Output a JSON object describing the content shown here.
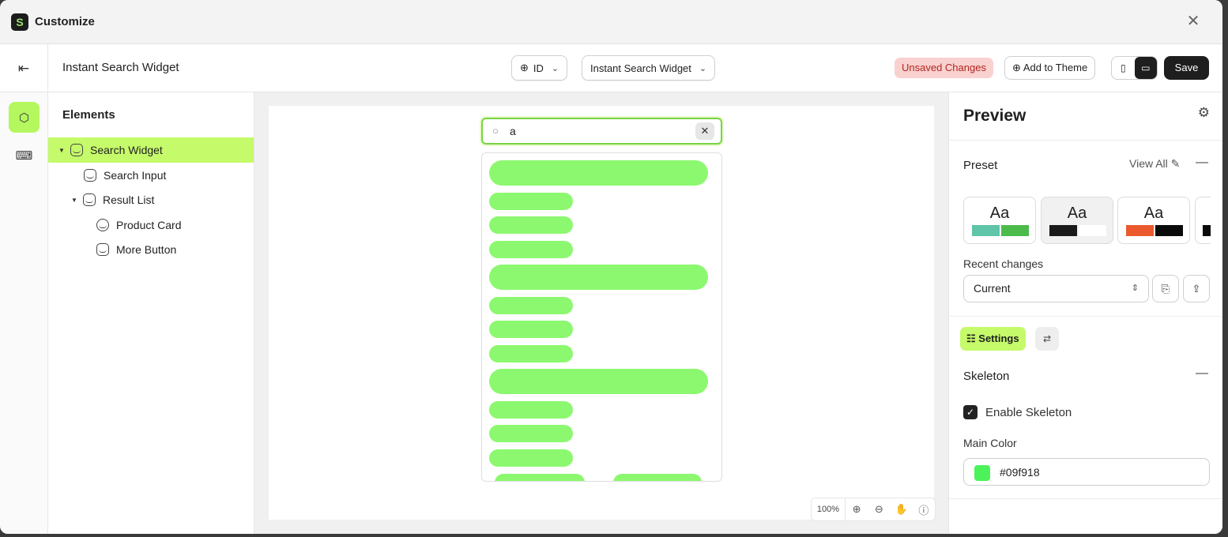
{
  "app": {
    "title": "Customize",
    "logo_letter": "S"
  },
  "toolbar": {
    "widget_name": "Instant Search Widget",
    "language": "ID",
    "widget_select": "Instant Search Widget",
    "unsaved": "Unsaved Changes",
    "add_to_theme": "Add to Theme",
    "save": "Save"
  },
  "elements": {
    "heading": "Elements",
    "tree": [
      {
        "label": "Search Widget",
        "selected": true
      },
      {
        "label": "Search Input"
      },
      {
        "label": "Result List"
      },
      {
        "label": "Product Card"
      },
      {
        "label": "More Button"
      }
    ]
  },
  "canvas": {
    "search_query": "a",
    "zoom": "100%",
    "skeleton_color": "#8cf86f"
  },
  "preview": {
    "title": "Preview",
    "preset_label": "Preset",
    "view_all": "View All",
    "presets": [
      {
        "label": "Aa",
        "colors": [
          "#5fc4a8",
          "#4cbb4c"
        ]
      },
      {
        "label": "Aa",
        "colors": [
          "#1a1a1a",
          "#ffffff"
        ]
      },
      {
        "label": "Aa",
        "colors": [
          "#ea5a2e",
          "#0a0a0a"
        ]
      }
    ],
    "recent_changes_label": "Recent changes",
    "recent_value": "Current",
    "settings_tab": "Settings",
    "skeleton_heading": "Skeleton",
    "enable_skeleton": "Enable Skeleton",
    "main_color_label": "Main Color",
    "main_color": "#09f918"
  },
  "colors": {
    "accent": "#c5fa6a",
    "unsaved_bg": "#f9d1cf",
    "unsaved_text": "#b3261e",
    "search_border": "#7ad348"
  }
}
